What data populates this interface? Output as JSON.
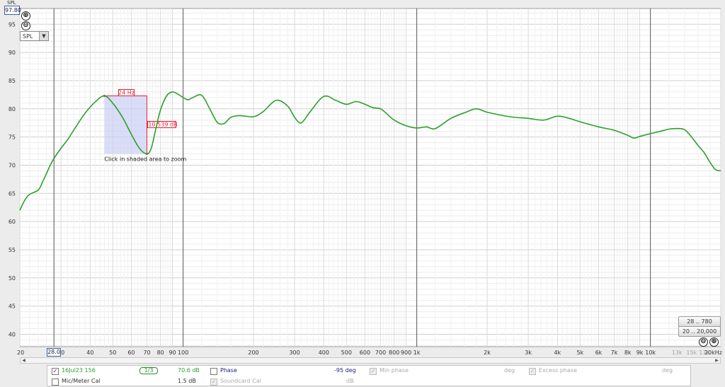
{
  "chart_data": {
    "type": "line",
    "ylabel": "SPL",
    "y_axis_max_label": "97.80",
    "ylim": [
      37.8,
      97.8
    ],
    "xlim": [
      20,
      20000
    ],
    "x_scale": "log",
    "y_ticks": [
      40,
      45,
      50,
      55,
      60,
      65,
      70,
      75,
      80,
      85,
      90,
      95
    ],
    "x_ticks": [
      {
        "v": 20,
        "label": "20"
      },
      {
        "v": 30,
        "label": "30"
      },
      {
        "v": 40,
        "label": "40"
      },
      {
        "v": 50,
        "label": "50"
      },
      {
        "v": 60,
        "label": "60"
      },
      {
        "v": 70,
        "label": "70"
      },
      {
        "v": 80,
        "label": "80"
      },
      {
        "v": 90,
        "label": "90"
      },
      {
        "v": 100,
        "label": "100"
      },
      {
        "v": 200,
        "label": "200"
      },
      {
        "v": 300,
        "label": "300"
      },
      {
        "v": 400,
        "label": "400"
      },
      {
        "v": 500,
        "label": "500"
      },
      {
        "v": 600,
        "label": "600"
      },
      {
        "v": 700,
        "label": "700"
      },
      {
        "v": 800,
        "label": "800"
      },
      {
        "v": 900,
        "label": "900"
      },
      {
        "v": 1000,
        "label": "1k"
      },
      {
        "v": 2000,
        "label": "2k"
      },
      {
        "v": 3000,
        "label": "3k"
      },
      {
        "v": 4000,
        "label": "4k"
      },
      {
        "v": 5000,
        "label": "5k"
      },
      {
        "v": 6000,
        "label": "6k"
      },
      {
        "v": 7000,
        "label": "7k"
      },
      {
        "v": 8000,
        "label": "8k"
      },
      {
        "v": 9000,
        "label": "9k"
      },
      {
        "v": 10000,
        "label": "10k"
      },
      {
        "v": 13000,
        "label": "13k",
        "faint": true
      },
      {
        "v": 15000,
        "label": "15k",
        "faint": true
      },
      {
        "v": 17000,
        "label": "17k",
        "faint": true
      },
      {
        "v": 20000,
        "label": "20kHz"
      }
    ],
    "series": [
      {
        "name": "16Jul23 156",
        "color": "#2ca02c",
        "points": [
          [
            20,
            62.0
          ],
          [
            21,
            63.8
          ],
          [
            22,
            64.8
          ],
          [
            24,
            65.6
          ],
          [
            25,
            67.0
          ],
          [
            26,
            68.5
          ],
          [
            27,
            70.0
          ],
          [
            28,
            71.2
          ],
          [
            30,
            73.0
          ],
          [
            32,
            74.5
          ],
          [
            35,
            77.0
          ],
          [
            38,
            79.2
          ],
          [
            42,
            81.2
          ],
          [
            46,
            82.3
          ],
          [
            50,
            81.0
          ],
          [
            55,
            78.5
          ],
          [
            60,
            75.5
          ],
          [
            65,
            73.0
          ],
          [
            70,
            72.0
          ],
          [
            73,
            73.0
          ],
          [
            76,
            76.0
          ],
          [
            80,
            79.8
          ],
          [
            85,
            82.3
          ],
          [
            90,
            83.0
          ],
          [
            95,
            82.6
          ],
          [
            100,
            82.0
          ],
          [
            105,
            81.6
          ],
          [
            110,
            82.0
          ],
          [
            120,
            82.4
          ],
          [
            130,
            80.0
          ],
          [
            140,
            77.6
          ],
          [
            150,
            77.4
          ],
          [
            160,
            78.5
          ],
          [
            175,
            78.8
          ],
          [
            200,
            78.6
          ],
          [
            220,
            79.5
          ],
          [
            250,
            81.5
          ],
          [
            280,
            80.5
          ],
          [
            300,
            78.5
          ],
          [
            320,
            77.5
          ],
          [
            350,
            79.5
          ],
          [
            400,
            82.2
          ],
          [
            450,
            81.5
          ],
          [
            500,
            80.8
          ],
          [
            550,
            81.3
          ],
          [
            600,
            80.8
          ],
          [
            650,
            80.2
          ],
          [
            700,
            80.0
          ],
          [
            750,
            79.0
          ],
          [
            800,
            78.0
          ],
          [
            900,
            77.0
          ],
          [
            1000,
            76.6
          ],
          [
            1100,
            76.8
          ],
          [
            1200,
            76.5
          ],
          [
            1400,
            78.3
          ],
          [
            1600,
            79.3
          ],
          [
            1800,
            80.0
          ],
          [
            2000,
            79.4
          ],
          [
            2500,
            78.6
          ],
          [
            3000,
            78.3
          ],
          [
            3500,
            78.0
          ],
          [
            4000,
            78.7
          ],
          [
            4500,
            78.3
          ],
          [
            5000,
            77.7
          ],
          [
            6000,
            76.8
          ],
          [
            7000,
            76.2
          ],
          [
            8000,
            75.3
          ],
          [
            8500,
            74.8
          ],
          [
            9000,
            75.1
          ],
          [
            10000,
            75.6
          ],
          [
            11000,
            76.0
          ],
          [
            12000,
            76.4
          ],
          [
            13000,
            76.5
          ],
          [
            14000,
            76.3
          ],
          [
            15000,
            75.0
          ],
          [
            16000,
            73.5
          ],
          [
            17000,
            72.2
          ],
          [
            18000,
            70.5
          ],
          [
            19000,
            69.2
          ],
          [
            20000,
            69.0
          ]
        ]
      }
    ],
    "selection": {
      "f1": 46,
      "f2": 70,
      "width_label": "24 Hz",
      "height_label": "-10.539 dB",
      "hint": "Click in shaded area to zoom"
    },
    "cursor_x_label": "28.0"
  },
  "controls": {
    "zoom_in": "⊕",
    "zoom_out": "⊖",
    "graph_select": "SPL",
    "range_buttons": [
      "20 .. 20,000",
      "28 .. 780"
    ]
  },
  "legend": {
    "row1": {
      "checked": "✓",
      "name": "16Jul23 156",
      "smoothing": "1/3",
      "level": "70.6 dB",
      "phase": "Phase",
      "phase_value": "-95 deg",
      "min_phase": "Min phase",
      "min_phase_unit": "deg",
      "excess_phase": "Excess phase",
      "excess_phase_unit": "deg"
    },
    "row2": {
      "mic_cal": "Mic/Meter Cal",
      "mic_value": "1.5 dB",
      "soundcard_cal": "Soundcard Cal",
      "soundcard_unit": "dB"
    }
  }
}
